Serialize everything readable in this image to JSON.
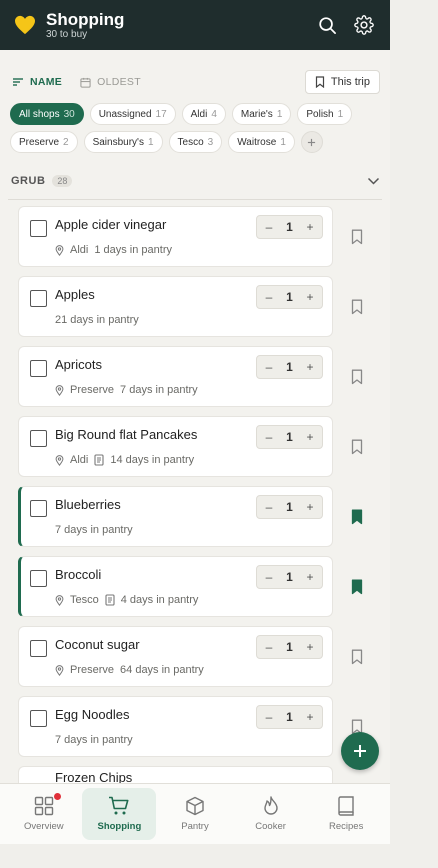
{
  "header": {
    "title": "Shopping",
    "subtitle": "30 to buy"
  },
  "sort": {
    "name_label": "NAME",
    "oldest_label": "OLDEST",
    "trip_label": "This trip"
  },
  "chips": [
    {
      "label": "All shops",
      "count": "30",
      "active": true
    },
    {
      "label": "Unassigned",
      "count": "17"
    },
    {
      "label": "Aldi",
      "count": "4"
    },
    {
      "label": "Marie's",
      "count": "1"
    },
    {
      "label": "Polish",
      "count": "1"
    },
    {
      "label": "Preserve",
      "count": "2"
    },
    {
      "label": "Sainsbury's",
      "count": "1"
    },
    {
      "label": "Tesco",
      "count": "3"
    },
    {
      "label": "Waitrose",
      "count": "1"
    }
  ],
  "section": {
    "title": "GRUB",
    "count": "28"
  },
  "items": [
    {
      "name": "Apple cider vinegar",
      "shop": "Aldi",
      "note": false,
      "pantry": "1 days in pantry",
      "qty": "1",
      "flagged": false
    },
    {
      "name": "Apples",
      "shop": "",
      "note": false,
      "pantry": "21 days in pantry",
      "qty": "1",
      "flagged": false
    },
    {
      "name": "Apricots",
      "shop": "Preserve",
      "note": false,
      "pantry": "7 days in pantry",
      "qty": "1",
      "flagged": false
    },
    {
      "name": "Big Round flat Pancakes",
      "shop": "Aldi",
      "note": true,
      "pantry": "14 days in pantry",
      "qty": "1",
      "flagged": false
    },
    {
      "name": "Blueberries",
      "shop": "",
      "note": false,
      "pantry": "7 days in pantry",
      "qty": "1",
      "flagged": true
    },
    {
      "name": "Broccoli",
      "shop": "Tesco",
      "note": true,
      "pantry": "4 days in pantry",
      "qty": "1",
      "flagged": true
    },
    {
      "name": "Coconut sugar",
      "shop": "Preserve",
      "note": false,
      "pantry": "64 days in pantry",
      "qty": "1",
      "flagged": false
    },
    {
      "name": "Egg Noodles",
      "shop": "",
      "note": false,
      "pantry": "7 days in pantry",
      "qty": "1",
      "flagged": false
    }
  ],
  "partial_item": {
    "name": "Frozen Chips"
  },
  "nav": [
    {
      "label": "Overview",
      "icon": "grid-icon",
      "active": false,
      "badge": true
    },
    {
      "label": "Shopping",
      "icon": "cart-icon",
      "active": true
    },
    {
      "label": "Pantry",
      "icon": "box-icon",
      "active": false
    },
    {
      "label": "Cooker",
      "icon": "flame-icon",
      "active": false
    },
    {
      "label": "Recipes",
      "icon": "book-icon",
      "active": false
    }
  ],
  "colors": {
    "header_bg": "#1f2d2d",
    "accent": "#1f6b4f",
    "badge": "#e0303a",
    "logo": "#f5c518"
  }
}
